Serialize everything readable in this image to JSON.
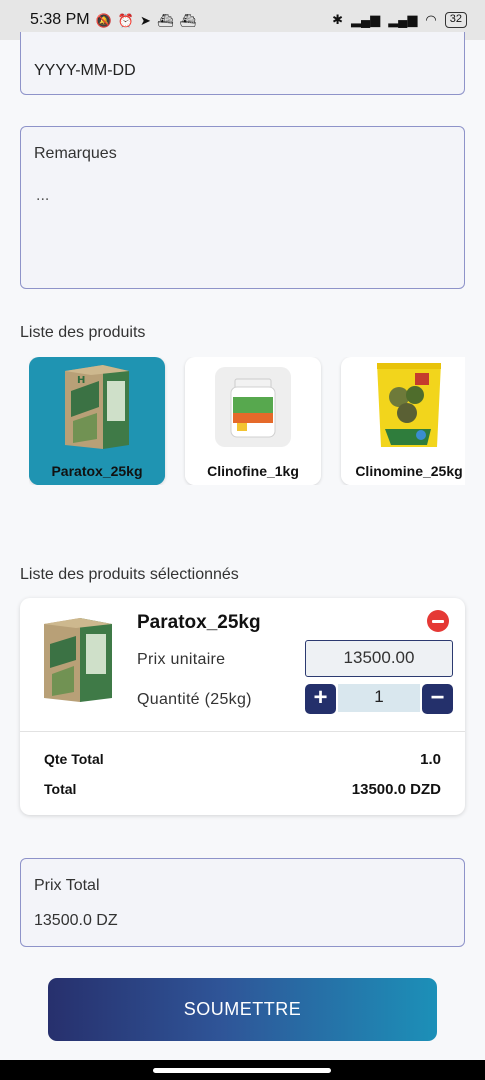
{
  "status_bar": {
    "time": "5:38 PM",
    "left_icons": [
      "mute-icon",
      "alarm-icon",
      "telegram-icon",
      "boat-icon",
      "boat-icon"
    ],
    "right_icons": [
      "bluetooth-icon",
      "signal-icon",
      "signal-icon",
      "wifi-icon"
    ],
    "battery": "32"
  },
  "form": {
    "date_value": "YYYY-MM-DD",
    "remarks_label": "Remarques",
    "remarks_placeholder": "..."
  },
  "products": {
    "title": "Liste des produits",
    "items": [
      {
        "name": "Paratox_25kg",
        "selected": true
      },
      {
        "name": "Clinofine_1kg",
        "selected": false
      },
      {
        "name": "Clinomine_25kg",
        "selected": false
      }
    ]
  },
  "selected": {
    "title": "Liste des produits sélectionnés",
    "item": {
      "name": "Paratox_25kg",
      "unit_price_label": "Prix unitaire",
      "unit_price": "13500.00",
      "quantity_label": "Quantité (25kg)",
      "quantity": "1",
      "plus": "+",
      "minus": "−"
    },
    "summary": {
      "qty_total_label": "Qte Total",
      "qty_total": "1.0",
      "total_label": "Total",
      "total": "13500.0 DZD"
    }
  },
  "price_total": {
    "label": "Prix Total",
    "value": "13500.0 DZ"
  },
  "submit_label": "SOUMETTRE",
  "colors": {
    "accent_dark": "#24306b",
    "accent_teal": "#1f94b2",
    "remove_red": "#e53935",
    "field_border": "#8e93c9"
  }
}
